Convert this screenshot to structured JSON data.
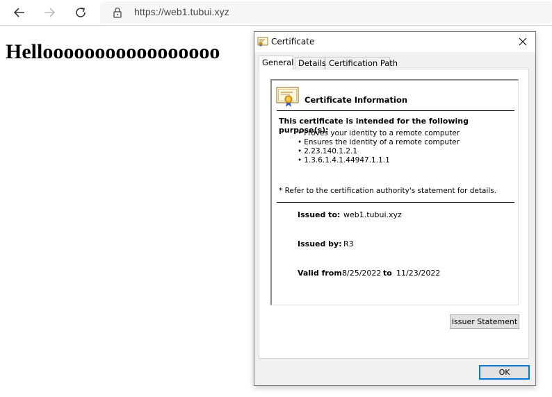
{
  "browser": {
    "url": "https://web1.tubui.xyz"
  },
  "page": {
    "headline": "Hellooooooooooooooooo"
  },
  "dialog": {
    "title": "Certificate",
    "tabs": [
      "General",
      "Details",
      "Certification Path"
    ],
    "info_title": "Certificate Information",
    "purpose_heading": "This certificate is intended for the following purpose(s):",
    "purposes": [
      "Proves your identity to a remote computer",
      "Ensures the identity of a remote computer",
      "2.23.140.1.2.1",
      "1.3.6.1.4.1.44947.1.1.1"
    ],
    "refer_note": "* Refer to the certification authority's statement for details.",
    "issued_to_label": "Issued to:",
    "issued_to_value": "web1.tubui.xyz",
    "issued_by_label": "Issued by:",
    "issued_by_value": "R3",
    "valid_from_label": "Valid from",
    "valid_from_value": "8/25/2022",
    "valid_to_label": "to",
    "valid_to_value": "11/23/2022",
    "issuer_statement_button": "Issuer Statement",
    "ok_button": "OK"
  },
  "icons": [
    "back-arrow-icon",
    "forward-arrow-icon",
    "refresh-icon",
    "lock-icon",
    "certificate-icon",
    "close-icon"
  ],
  "colors": {
    "accent": "#0078d7",
    "dialog_bg": "#f0f0f0"
  }
}
